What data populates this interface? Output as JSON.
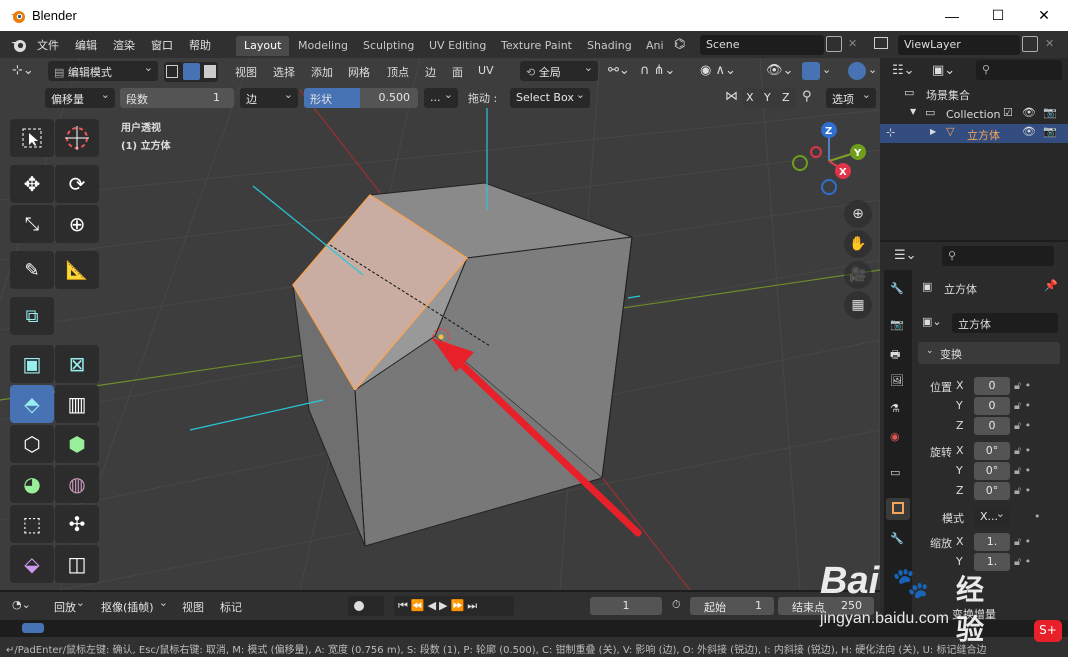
{
  "title_bar": {
    "app_title": "Blender",
    "minimize": "—",
    "maximize": "☐",
    "close": "✕"
  },
  "top_menu": {
    "items": [
      "文件",
      "编辑",
      "渲染",
      "窗口",
      "帮助"
    ]
  },
  "workspaces": [
    "Layout",
    "Modeling",
    "Sculpting",
    "UV Editing",
    "Texture Paint",
    "Shading",
    "Ani"
  ],
  "scene": {
    "label": "Scene",
    "viewlayer": "ViewLayer"
  },
  "viewport_header": {
    "mode": "编辑模式",
    "menus": [
      "视图",
      "选择",
      "添加",
      "网格",
      "顶点",
      "边",
      "面",
      "UV"
    ],
    "transform_orientation": "全局"
  },
  "tool_header": {
    "operation": "偏移量",
    "segments_label": "段数",
    "segments_value": "1",
    "affect": "边",
    "shape_label": "形状",
    "shape_value": "0.500",
    "more": "...",
    "drag_label": "拖动 :",
    "select_mode": "Select Box",
    "axis_x": "X",
    "axis_y": "Y",
    "axis_z": "Z",
    "options": "选项"
  },
  "viewport_info": {
    "view_name": "用户透视",
    "object_info": "(1) 立方体"
  },
  "gizmo": {
    "z": "Z",
    "y": "Y",
    "x": "X"
  },
  "outliner": {
    "scene_collection": "场景集合",
    "collection": "Collection",
    "object": "立方体"
  },
  "properties": {
    "object_name": "立方体",
    "data_name": "立方体",
    "section": "变换",
    "location_label": "位置",
    "rotation_label": "旋转",
    "scale_label": "缩放",
    "mode_label": "模式",
    "mode_value": "X...",
    "location": {
      "x": "0",
      "y": "0",
      "z": "0"
    },
    "rotation": {
      "x": "0°",
      "y": "0°",
      "z": "0°"
    },
    "scale": {
      "x": "1.",
      "y": "1."
    },
    "delta": "变换增量",
    "axes": [
      "X",
      "Y",
      "Z"
    ]
  },
  "timeline": {
    "playback": "回放",
    "keying": "抠像(插帧)",
    "view": "视图",
    "marker": "标记",
    "current_frame": "1",
    "start_label": "起始",
    "start_value": "1",
    "end_label": "结束点",
    "end_value": "250"
  },
  "status_bar": "↵/PadEnter/鼠标左键: 确认, Esc/鼠标右键: 取消, M: 模式 (偏移量), A: 宽度 (0.756 m), S: 段数 (1), P: 轮廓 (0.500), C: 钳制重叠 (关), V: 影响 (边), O: 外斜接 (锐边), I: 内斜接 (锐边), H: 硬化法向 (关), U: 标记缝合边",
  "watermark": {
    "brand": "Bai",
    "brand2": "经验",
    "url": "jingyan.baidu.com"
  },
  "colors": {
    "accent": "#4772b3",
    "selection": "#f5a55a",
    "arrow": "#e8202a"
  }
}
